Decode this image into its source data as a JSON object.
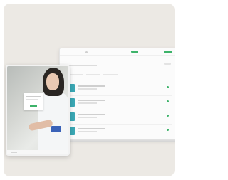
{
  "laptop_app": {
    "title": "",
    "accent_color": "#3db36a",
    "document_color": "#3aa7b4",
    "rows": [
      {
        "icon": "document-icon",
        "status_icon": "check-icon"
      },
      {
        "icon": "document-icon",
        "status_icon": "check-icon"
      },
      {
        "icon": "document-icon",
        "status_icon": "check-icon"
      },
      {
        "icon": "document-icon",
        "status_icon": "check-icon"
      }
    ]
  },
  "tablet_app": {
    "dialog_button_color": "#3db36a"
  }
}
